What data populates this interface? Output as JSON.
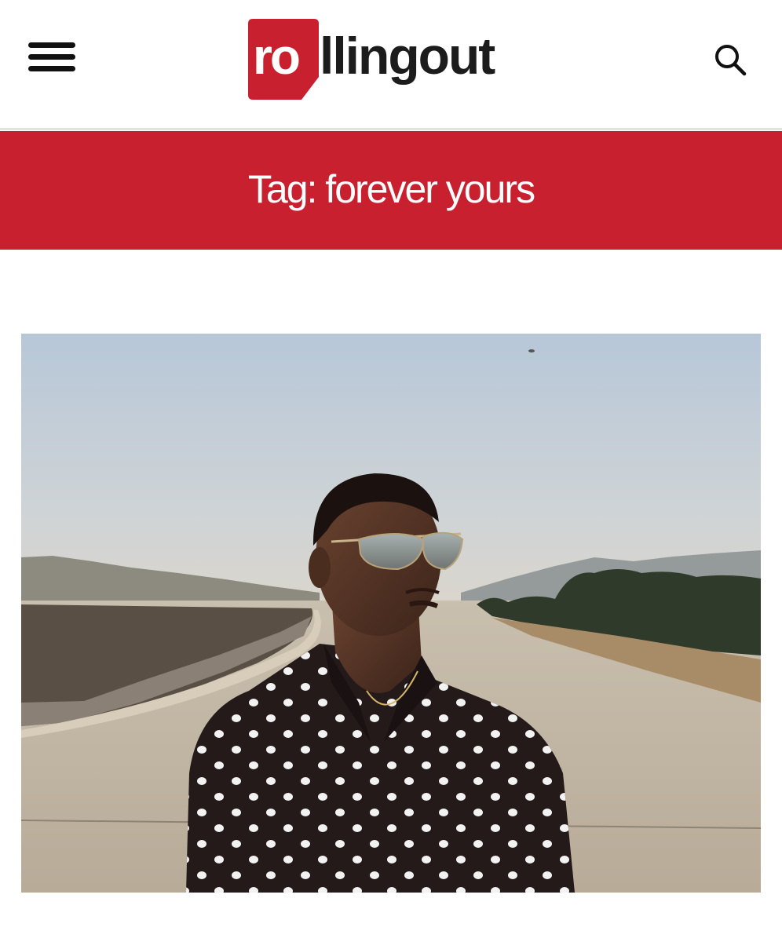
{
  "header": {
    "menu_icon": "hamburger-menu-icon",
    "logo": {
      "highlight": "ro",
      "rest": "llingout"
    },
    "search_icon": "search-icon"
  },
  "tag_banner": {
    "title": "Tag: forever yours"
  },
  "colors": {
    "brand_red": "#c8202f",
    "logo_text": "#1c1c1c",
    "background": "#ffffff"
  }
}
